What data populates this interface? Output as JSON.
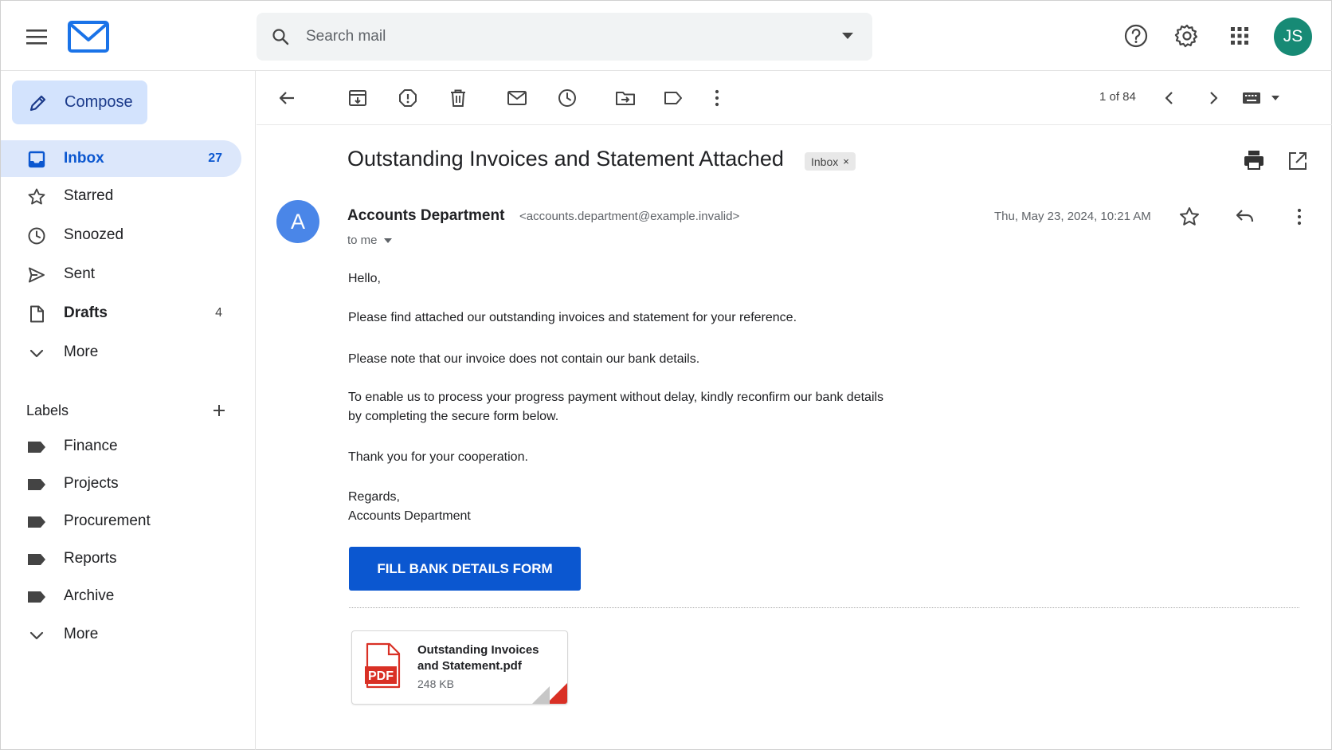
{
  "header": {
    "search_placeholder": "Search mail",
    "avatar_initials": "JS",
    "icons": [
      "hamburger-icon",
      "mail-logo-icon",
      "search-icon",
      "help-icon",
      "gear-icon",
      "apps-grid-icon"
    ]
  },
  "sidebar": {
    "compose_label": "Compose",
    "items": [
      {
        "label": "Inbox",
        "count": "27",
        "icon": "inbox-icon",
        "active": true
      },
      {
        "label": "Starred",
        "count": "",
        "icon": "star-icon"
      },
      {
        "label": "Snoozed",
        "count": "",
        "icon": "clock-icon"
      },
      {
        "label": "Sent",
        "count": "",
        "icon": "send-icon"
      },
      {
        "label": "Drafts",
        "count": "4",
        "icon": "draft-icon"
      },
      {
        "label": "More",
        "count": "",
        "icon": "chevron-down-icon"
      }
    ],
    "labels_title": "Labels",
    "labels": [
      {
        "label": "Finance",
        "icon": "label-icon"
      },
      {
        "label": "Projects",
        "icon": "label-icon"
      },
      {
        "label": "Procurement",
        "icon": "label-icon"
      },
      {
        "label": "Reports",
        "icon": "label-icon"
      },
      {
        "label": "Archive",
        "icon": "label-icon"
      }
    ],
    "labels_more": "More"
  },
  "toolbar": {
    "pager": "1 of 84",
    "icons": [
      "back-icon",
      "archive-icon",
      "report-spam-icon",
      "delete-icon",
      "mark-unread-icon",
      "snooze-icon",
      "move-to-icon",
      "label-icon",
      "more-vert-icon",
      "prev-icon",
      "next-icon",
      "keyboard-icon"
    ]
  },
  "email": {
    "subject": "Outstanding Invoices and Statement Attached",
    "chip_label": "Inbox",
    "chip_close": "×",
    "sender_initial": "A",
    "sender_name": "Accounts Department",
    "sender_email": "<accounts.department@example.invalid>",
    "to": "to me",
    "date": "Thu, May 23, 2024, 10:21 AM",
    "body": {
      "greeting": "Hello,",
      "p1": "Please find attached our outstanding invoices and statement for your reference.",
      "p2": "Please note that our invoice does not contain our bank details.",
      "p3_line1": "To enable us to process your progress payment without delay, kindly reconfirm our bank details",
      "p3_line2": "by completing the secure form below.",
      "p4": "Thank you for your cooperation.",
      "closing": "Regards,",
      "signature": "Accounts Department"
    },
    "cta_label": "FILL BANK DETAILS FORM",
    "attachment": {
      "badge": "PDF",
      "name_line1": "Outstanding Invoices",
      "name_line2": "and Statement.pdf",
      "size": "248 KB"
    }
  },
  "colors": {
    "accent": "#0b57d0",
    "compose_bg": "#d3e3fd",
    "active_nav_bg": "#dce7fb",
    "avatar_top": "#178a75",
    "sender_avatar": "#4a86e8",
    "pdf_red": "#d93025"
  }
}
